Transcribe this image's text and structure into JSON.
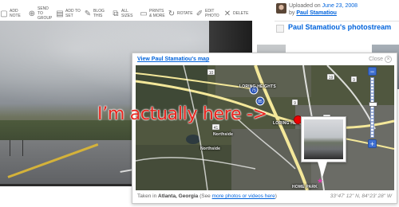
{
  "toolbar": {
    "items": [
      {
        "icon": "add-note-icon",
        "label": "Add Note"
      },
      {
        "icon": "send-to-group-icon",
        "label": "Send to Group"
      },
      {
        "icon": "add-to-set-icon",
        "label": "Add to Set"
      },
      {
        "icon": "blog-this-icon",
        "label": "Blog This"
      },
      {
        "icon": "all-sizes-icon",
        "label": "All Sizes"
      },
      {
        "icon": "prints-icon",
        "label": "Prints & More"
      },
      {
        "icon": "rotate-icon",
        "label": "Rotate"
      },
      {
        "icon": "edit-photo-icon",
        "label": "Edit Photo"
      },
      {
        "icon": "delete-icon",
        "label": "Delete"
      }
    ]
  },
  "sidebar": {
    "uploaded_prefix": "Uploaded on",
    "uploaded_date": "June 23, 2008",
    "by_prefix": "by",
    "uploader_name": "Paul Stamatiou",
    "photostream_title": "Paul Stamatiou's photostream"
  },
  "map_popup": {
    "title": "View Paul Stamatiou's map",
    "close_label": "Close",
    "taken_in_prefix": "Taken in",
    "location": "Atlanta, Georgia",
    "see_prefix": "(See",
    "more_link": "more photos or videos here",
    "see_suffix": ")",
    "coordinates": "33°47' 12\" N, 84°23' 28\" W",
    "annotation": "I’m actually here ->",
    "labels": {
      "loring_heights": "LORING HEIGHTS",
      "loring_heights_2": "LORING HEIGHTS",
      "home_park": "HOME PARK",
      "northside": "Northside",
      "northside_2": "Northside"
    },
    "shields": [
      "75",
      "85",
      "19",
      "9",
      "9",
      "19",
      "10",
      "41"
    ],
    "zoom": {
      "plus": "+",
      "minus": "−"
    }
  }
}
